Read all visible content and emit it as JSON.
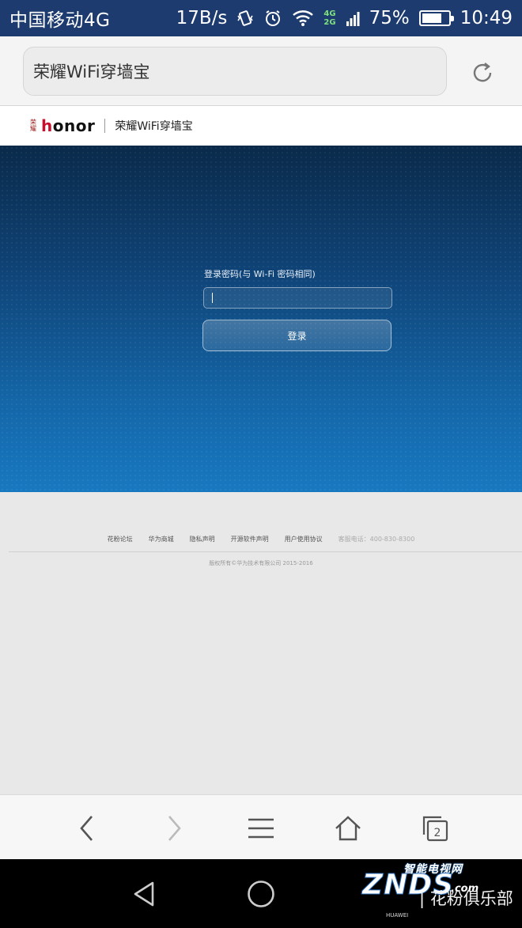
{
  "status_bar": {
    "carrier": "中国移动4G",
    "speed": "17B/s",
    "net_badge_top": "4G",
    "net_badge_bottom": "2G",
    "battery_percent": "75%",
    "battery_level": 0.75,
    "time": "10:49"
  },
  "address_bar": {
    "url_text": "荣耀WiFi穿墙宝"
  },
  "header": {
    "logo_cn": "荣耀",
    "logo_h": "h",
    "logo_rest": "onor",
    "title": "荣耀WiFi穿墙宝"
  },
  "login": {
    "label": "登录密码(与 Wi-Fi 密码相同)",
    "password_value": "",
    "button": "登录"
  },
  "footer": {
    "links": [
      "花粉论坛",
      "华为商城",
      "隐私声明",
      "开源软件声明",
      "用户使用协议"
    ],
    "phone": "客服电话：400-830-8300",
    "copyright": "版权所有©华为技术有限公司 2015-2016"
  },
  "browser_toolbar": {
    "tabs_count": "2"
  },
  "watermark": {
    "top": "智能电视网",
    "logo": "ZNDS",
    "com": ".com",
    "huawei": "HUAWEI",
    "club": "| 花粉俱乐部"
  }
}
